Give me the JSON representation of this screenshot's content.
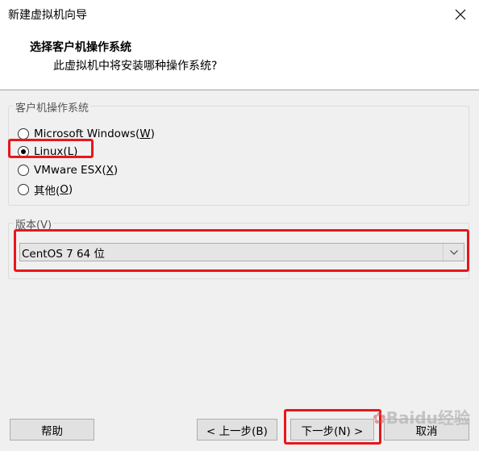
{
  "window": {
    "title": "新建虚拟机向导"
  },
  "header": {
    "title": "选择客户机操作系统",
    "subtitle": "此虚拟机中将安装哪种操作系统?"
  },
  "guest_os": {
    "legend": "客户机操作系统",
    "options": [
      {
        "text": "Microsoft Windows(",
        "mnemonic": "W",
        "suffix": ")",
        "checked": false
      },
      {
        "text": "Linux(",
        "mnemonic": "L",
        "suffix": ")",
        "checked": true
      },
      {
        "text": "VMware ESX(",
        "mnemonic": "X",
        "suffix": ")",
        "checked": false
      },
      {
        "text": "其他(",
        "mnemonic": "O",
        "suffix": ")",
        "checked": false
      }
    ]
  },
  "version": {
    "legend": "版本(V)",
    "selected": "CentOS 7 64 位"
  },
  "buttons": {
    "help": "帮助",
    "back": "< 上一步(B)",
    "next": "下一步(N) >",
    "cancel": "取消"
  },
  "watermark": {
    "text": "Baidu经验"
  },
  "colors": {
    "highlight": "#e8161b",
    "background": "#f0f0f0"
  }
}
